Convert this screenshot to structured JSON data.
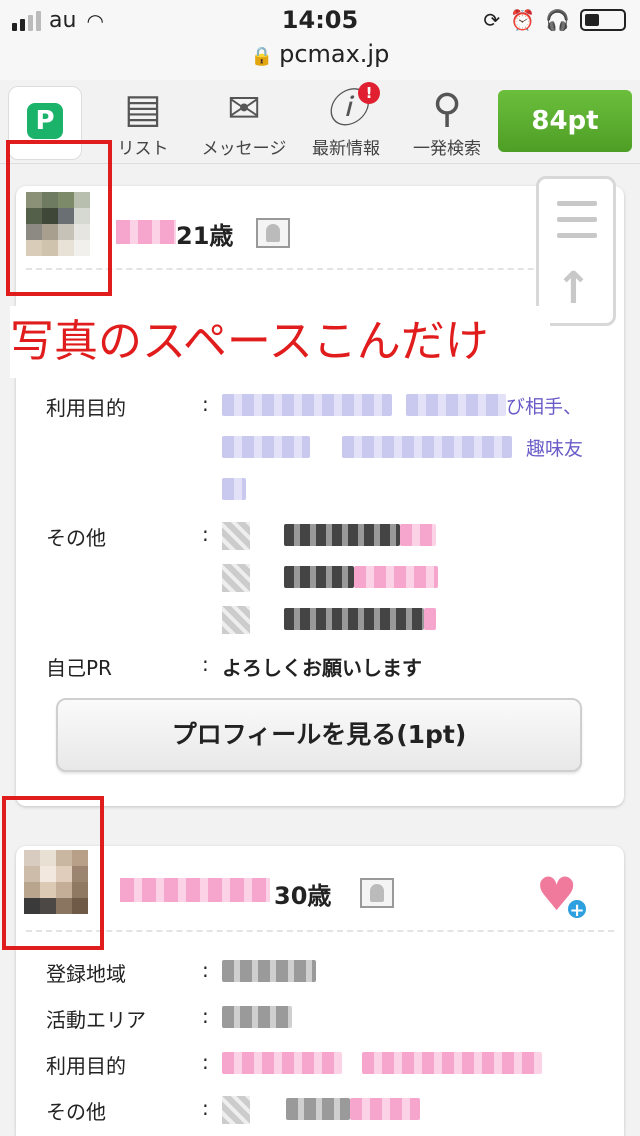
{
  "status": {
    "carrier": "au",
    "time": "14:05"
  },
  "browser": {
    "url": "pcmax.jp"
  },
  "nav": {
    "logo": "P",
    "items": [
      {
        "label": "リスト",
        "icon": "list-icon"
      },
      {
        "label": "メッセージ",
        "icon": "mail-icon"
      },
      {
        "label": "最新情報",
        "icon": "info-icon",
        "badge": "!"
      },
      {
        "label": "一発検索",
        "icon": "search-icon"
      }
    ],
    "points": "84pt"
  },
  "profiles": [
    {
      "age": "21歳",
      "fields": {
        "purpose_label": "利用目的",
        "purpose_visible_1": "び相手、",
        "purpose_visible_2": "趣味友",
        "other_label": "その他",
        "pr_label": "自己PR",
        "pr_text": "よろしくお願いします"
      },
      "button": "プロフィールを見る(1pt)"
    },
    {
      "age": "30歳",
      "fields": {
        "region_label": "登録地域",
        "area_label": "活動エリア",
        "purpose_label": "利用目的",
        "other_label": "その他"
      }
    }
  ],
  "annotation": "写真のスペースこんだけ",
  "colors": {
    "annotation": "#e01c1c",
    "points_button": "#5aae2e",
    "accent_purple": "#6a5cc8"
  }
}
